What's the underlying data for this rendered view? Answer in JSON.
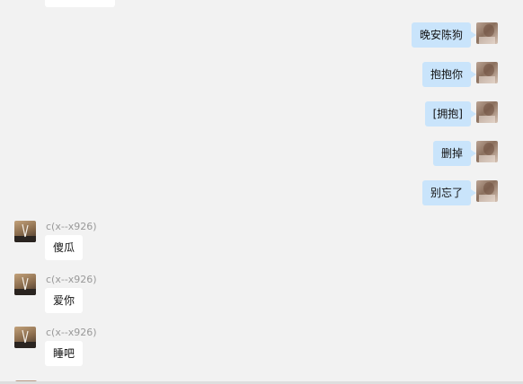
{
  "chat": {
    "self_messages": [
      {
        "text": "晚安陈狗"
      },
      {
        "text": "抱抱你"
      },
      {
        "text": "[拥抱]"
      },
      {
        "text": "删掉"
      },
      {
        "text": "别忘了"
      }
    ],
    "other_messages": [
      {
        "sender": "c(x--x926)",
        "text": "傻瓜"
      },
      {
        "sender": "c(x--x926)",
        "text": "爱你"
      },
      {
        "sender": "c(x--x926)",
        "text": "睡吧"
      }
    ]
  },
  "colors": {
    "background": "#f2f2f2",
    "self_bubble": "#c9e4fb",
    "other_bubble": "#ffffff",
    "sender_name": "#999999"
  }
}
